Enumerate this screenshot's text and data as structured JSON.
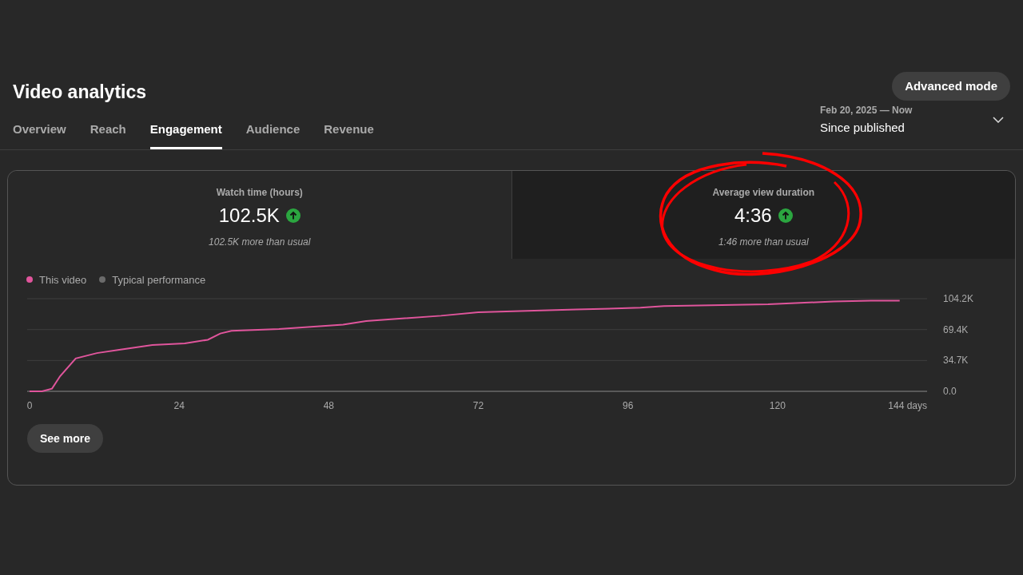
{
  "page": {
    "title": "Video analytics",
    "advanced_button": "Advanced mode"
  },
  "tabs": [
    {
      "label": "Overview",
      "selected": false
    },
    {
      "label": "Reach",
      "selected": false
    },
    {
      "label": "Engagement",
      "selected": true
    },
    {
      "label": "Audience",
      "selected": false
    },
    {
      "label": "Revenue",
      "selected": false
    }
  ],
  "date_range": {
    "range": "Feb 20, 2025 — Now",
    "label": "Since published"
  },
  "metrics": [
    {
      "title": "Watch time (hours)",
      "value": "102.5K",
      "up": true,
      "note": "102.5K more than usual",
      "selected": false
    },
    {
      "title": "Average view duration",
      "value": "4:36",
      "up": true,
      "note": "1:46 more than usual",
      "selected": true
    }
  ],
  "legend": [
    {
      "label": "This video",
      "color": "#e0559c"
    },
    {
      "label": "Typical performance",
      "color": "#6b6b6b"
    }
  ],
  "chart_data": {
    "type": "line",
    "x": [
      0,
      2,
      3.6,
      4.9,
      7.4,
      10.8,
      14.6,
      19.7,
      24.9,
      28.6,
      30.6,
      32.4,
      40,
      50.3,
      54,
      66,
      72,
      87.7,
      98,
      101.8,
      118.5,
      129,
      135,
      139.6
    ],
    "series": [
      {
        "color": "#e0559c",
        "values": [
          0,
          0,
          3000,
          17000,
          37000,
          43000,
          47000,
          52000,
          54000,
          58000,
          65000,
          68000,
          70000,
          75000,
          79000,
          85000,
          89000,
          92000,
          94000,
          96000,
          98000,
          101000,
          102000,
          102000
        ]
      }
    ],
    "xlim": [
      0,
      144
    ],
    "ylim": [
      0,
      104200
    ],
    "xticks": [
      0,
      24,
      48,
      72,
      96,
      120,
      {
        "value": 144,
        "label": "144 days"
      }
    ],
    "yticks": [
      {
        "value": 0,
        "label": "0.0"
      },
      {
        "value": 34700,
        "label": "34.7K"
      },
      {
        "value": 69400,
        "label": "69.4K"
      },
      {
        "value": 104200,
        "label": "104.2K"
      }
    ]
  },
  "see_more": "See more"
}
